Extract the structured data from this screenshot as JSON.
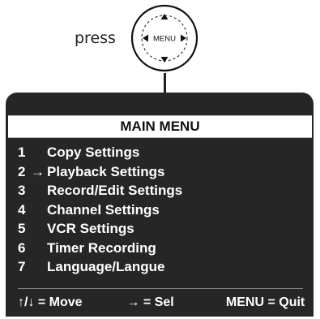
{
  "press_label": "press",
  "dial": {
    "center_label": "MENU",
    "up_icon": "triangle-up",
    "down_icon": "triangle-down",
    "left_icon": "triangle-left",
    "right_icon": "triangle-right"
  },
  "menu": {
    "title": "MAIN MENU",
    "items": [
      {
        "number": "1",
        "cursor": "",
        "label": "Copy Settings"
      },
      {
        "number": "2",
        "cursor": "→",
        "label": "Playback Settings"
      },
      {
        "number": "3",
        "cursor": "",
        "label": "Record/Edit Settings"
      },
      {
        "number": "4",
        "cursor": "",
        "label": "Channel Settings"
      },
      {
        "number": "5",
        "cursor": "",
        "label": "VCR Settings"
      },
      {
        "number": "6",
        "cursor": "",
        "label": "Timer Recording"
      },
      {
        "number": "7",
        "cursor": "",
        "label": "Language/Langue"
      }
    ]
  },
  "footer": {
    "move": "↑/↓ = Move",
    "sel": "→ = Sel",
    "quit": "MENU = Quit"
  },
  "colors": {
    "screen_bg": "#262626",
    "menu_text": "#ffffff",
    "title_bg": "#ffffff"
  }
}
